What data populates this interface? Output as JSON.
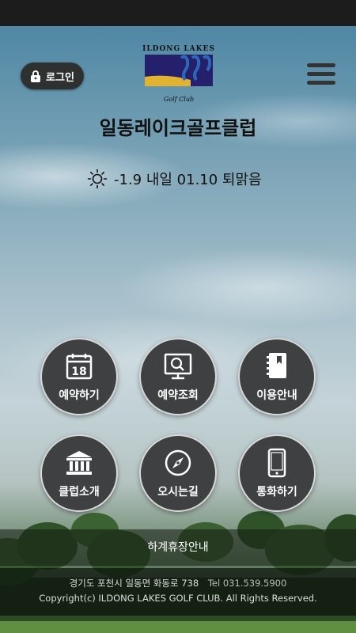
{
  "header": {
    "login_label": "로그인",
    "logo_top": "ILDONG LAKES",
    "logo_bottom": "Golf Club",
    "title": "일동레이크골프클럽"
  },
  "weather": {
    "icon": "sun-icon",
    "text": "-1.9 내일 01.10 퇴맑음"
  },
  "menu": [
    {
      "label": "예약하기",
      "icon": "calendar-icon"
    },
    {
      "label": "예약조회",
      "icon": "monitor-search-icon"
    },
    {
      "label": "이용안내",
      "icon": "guide-book-icon"
    },
    {
      "label": "클럽소개",
      "icon": "building-icon"
    },
    {
      "label": "오시는길",
      "icon": "compass-icon"
    },
    {
      "label": "통화하기",
      "icon": "phone-icon"
    }
  ],
  "calendar_day": "18",
  "notice": "하계휴장안내",
  "footer": {
    "address": "경기도 포천시 일동면 화동로 738",
    "tel": "Tel 031.539.5900",
    "copyright": "Copyright(c) ILDONG LAKES GOLF CLUB. All Rights Reserved."
  },
  "colors": {
    "button_bg": "#3f4041",
    "button_border": "#d8d8d8",
    "logo_navy": "#24206b",
    "logo_gold": "#e1b331",
    "logo_blue": "#2e66b8"
  }
}
